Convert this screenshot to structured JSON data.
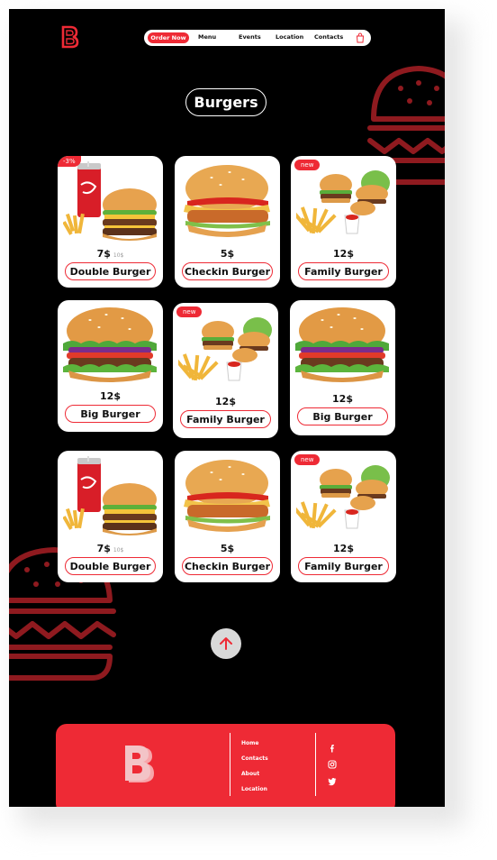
{
  "brand": {
    "logo_letter": "B",
    "accent_color": "#ee2a35"
  },
  "nav": {
    "order_label": "Order Now",
    "items": [
      "Menu",
      "Events",
      "Location",
      "Contacts"
    ],
    "cart_icon": "shopping-bag-icon"
  },
  "section_title": "Burgers",
  "cards": [
    {
      "name": "Double Burger",
      "price": "7$",
      "old_price": "10$",
      "badge": "-3%",
      "image": "combo-cola-fries-burger"
    },
    {
      "name": "Checkin Burger",
      "price": "5$",
      "old_price": "",
      "badge": "",
      "image": "chicken-burger"
    },
    {
      "name": "Family Burger",
      "price": "12$",
      "old_price": "",
      "badge": "new",
      "image": "family-burgers-fries"
    },
    {
      "name": "Big Burger",
      "price": "12$",
      "old_price": "",
      "badge": "",
      "image": "big-burger"
    },
    {
      "name": "Family Burger",
      "price": "12$",
      "old_price": "",
      "badge": "new",
      "image": "family-burgers-fries"
    },
    {
      "name": "Big Burger",
      "price": "12$",
      "old_price": "",
      "badge": "",
      "image": "big-burger"
    },
    {
      "name": "Double Burger",
      "price": "7$",
      "old_price": "10$",
      "badge": "",
      "image": "combo-cola-fries-burger"
    },
    {
      "name": "Checkin Burger",
      "price": "5$",
      "old_price": "",
      "badge": "",
      "image": "chicken-burger"
    },
    {
      "name": "Family Burger",
      "price": "12$",
      "old_price": "",
      "badge": "new",
      "image": "family-burgers-fries"
    }
  ],
  "scroll_top_icon": "arrow-up-icon",
  "footer": {
    "links": [
      "Home",
      "Contacts",
      "About",
      "Location"
    ],
    "social": [
      "facebook-icon",
      "instagram-icon",
      "twitter-icon"
    ]
  }
}
